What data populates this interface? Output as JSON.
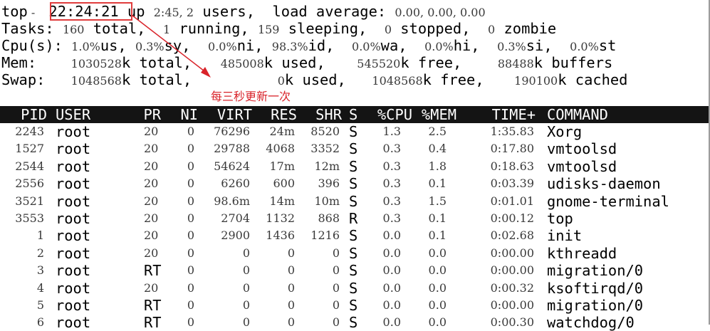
{
  "summary": {
    "cmd": "top",
    "dash": " - ",
    "time": "22:24:21",
    "up_label": " up ",
    "uptime": "2:45,",
    "users_count": "2",
    "users_label": " users,  load average: ",
    "load": "0.00, 0.00, 0.00",
    "tasks": {
      "label": "Tasks: ",
      "total": "160",
      "total_label": " total,  ",
      "running": "1",
      "running_label": " running, ",
      "sleeping": "159",
      "sleeping_label": " sleeping,  ",
      "stopped": "0",
      "stopped_label": " stopped,  ",
      "zombie": "0",
      "zombie_label": " zombie"
    },
    "cpu": {
      "label": "Cpu(s): ",
      "us": "1.0%",
      "us_label": "us, ",
      "sy": "0.3%",
      "sy_label": "sy,  ",
      "ni": "0.0%",
      "ni_label": "ni, ",
      "id": "98.3%",
      "id_label": "id,  ",
      "wa": "0.0%",
      "wa_label": "wa,  ",
      "hi": "0.0%",
      "hi_label": "hi,  ",
      "si": "0.3%",
      "si_label": "si,  ",
      "st": "0.0%",
      "st_label": "st"
    },
    "mem": {
      "label": "Mem:  ",
      "total": "1030528",
      "total_label": "k total,  ",
      "used": "485008",
      "used_label": "k used,  ",
      "free": "545520",
      "free_label": "k free,  ",
      "buffers": "88488",
      "buffers_label": "k buffers"
    },
    "swap": {
      "label": "Swap: ",
      "total": "1048568",
      "total_label": "k total,  ",
      "used": "0",
      "used_label": "k used,  ",
      "free": "1048568",
      "free_label": "k free,  ",
      "cached": "190100",
      "cached_label": "k cached"
    }
  },
  "annotation": {
    "text": "每三秒更新一次",
    "color": "#d9232a"
  },
  "table": {
    "header": {
      "pid": "PID",
      "user": "USER",
      "pr": "PR",
      "ni": "NI",
      "virt": "VIRT",
      "res": "RES",
      "shr": "SHR",
      "s": "S",
      "cpu": "%CPU",
      "mem": "%MEM",
      "time": "TIME+",
      "command": "COMMAND"
    },
    "rows": [
      {
        "pid": "2243",
        "user": "root",
        "pr": "20",
        "ni": "0",
        "virt": "76296",
        "res": "24m",
        "shr": "8520",
        "s": "S",
        "cpu": "1.3",
        "mem": "2.5",
        "time": "1:35.83",
        "command": "Xorg"
      },
      {
        "pid": "1527",
        "user": "root",
        "pr": "20",
        "ni": "0",
        "virt": "29788",
        "res": "4068",
        "shr": "3352",
        "s": "S",
        "cpu": "0.3",
        "mem": "0.4",
        "time": "0:17.80",
        "command": "vmtoolsd"
      },
      {
        "pid": "2544",
        "user": "root",
        "pr": "20",
        "ni": "0",
        "virt": "54624",
        "res": "17m",
        "shr": "12m",
        "s": "S",
        "cpu": "0.3",
        "mem": "1.8",
        "time": "0:18.63",
        "command": "vmtoolsd"
      },
      {
        "pid": "2556",
        "user": "root",
        "pr": "20",
        "ni": "0",
        "virt": "6260",
        "res": "600",
        "shr": "396",
        "s": "S",
        "cpu": "0.3",
        "mem": "0.1",
        "time": "0:03.39",
        "command": "udisks-daemon"
      },
      {
        "pid": "3521",
        "user": "root",
        "pr": "20",
        "ni": "0",
        "virt": "98.6m",
        "res": "14m",
        "shr": "10m",
        "s": "S",
        "cpu": "0.3",
        "mem": "1.5",
        "time": "0:01.01",
        "command": "gnome-terminal"
      },
      {
        "pid": "3553",
        "user": "root",
        "pr": "20",
        "ni": "0",
        "virt": "2704",
        "res": "1132",
        "shr": "868",
        "s": "R",
        "cpu": "0.3",
        "mem": "0.1",
        "time": "0:00.12",
        "command": "top"
      },
      {
        "pid": "1",
        "user": "root",
        "pr": "20",
        "ni": "0",
        "virt": "2900",
        "res": "1436",
        "shr": "1216",
        "s": "S",
        "cpu": "0.0",
        "mem": "0.1",
        "time": "0:02.68",
        "command": "init"
      },
      {
        "pid": "2",
        "user": "root",
        "pr": "20",
        "ni": "0",
        "virt": "0",
        "res": "0",
        "shr": "0",
        "s": "S",
        "cpu": "0.0",
        "mem": "0.0",
        "time": "0:00.00",
        "command": "kthreadd"
      },
      {
        "pid": "3",
        "user": "root",
        "pr": "RT",
        "ni": "0",
        "virt": "0",
        "res": "0",
        "shr": "0",
        "s": "S",
        "cpu": "0.0",
        "mem": "0.0",
        "time": "0:00.00",
        "command": "migration/0"
      },
      {
        "pid": "4",
        "user": "root",
        "pr": "20",
        "ni": "0",
        "virt": "0",
        "res": "0",
        "shr": "0",
        "s": "S",
        "cpu": "0.0",
        "mem": "0.0",
        "time": "0:00.32",
        "command": "ksoftirqd/0"
      },
      {
        "pid": "5",
        "user": "root",
        "pr": "RT",
        "ni": "0",
        "virt": "0",
        "res": "0",
        "shr": "0",
        "s": "S",
        "cpu": "0.0",
        "mem": "0.0",
        "time": "0:00.00",
        "command": "migration/0"
      },
      {
        "pid": "6",
        "user": "root",
        "pr": "RT",
        "ni": "0",
        "virt": "0",
        "res": "0",
        "shr": "0",
        "s": "S",
        "cpu": "0.0",
        "mem": "0.0",
        "time": "0:00.30",
        "command": "watchdog/0"
      }
    ]
  }
}
